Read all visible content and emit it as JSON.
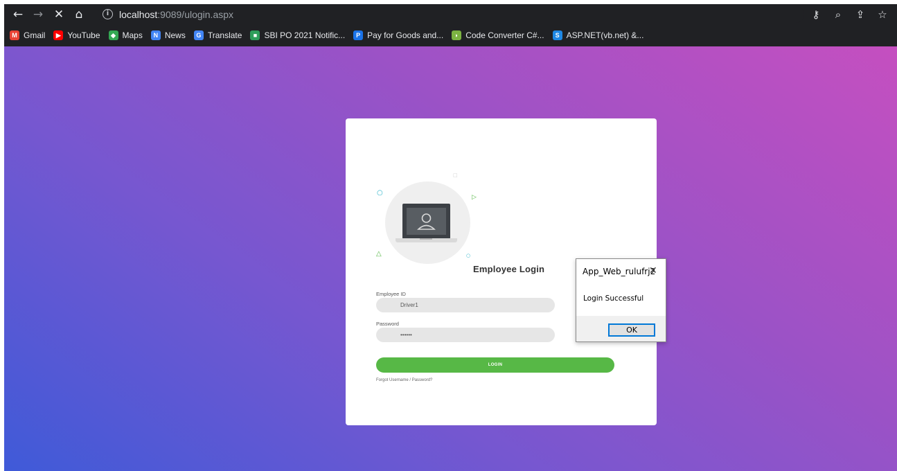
{
  "browser": {
    "url_host": "localhost",
    "url_rest": ":9089/ulogin.aspx",
    "bookmarks": [
      {
        "label": "Gmail",
        "icon": "gmail-icon",
        "color": "#ea4335",
        "glyph": "M"
      },
      {
        "label": "YouTube",
        "icon": "youtube-icon",
        "color": "#ff0000",
        "glyph": "▶"
      },
      {
        "label": "Maps",
        "icon": "maps-icon",
        "color": "#34a853",
        "glyph": "◆"
      },
      {
        "label": "News",
        "icon": "news-icon",
        "color": "#4285f4",
        "glyph": "N"
      },
      {
        "label": "Translate",
        "icon": "translate-icon",
        "color": "#4285f4",
        "glyph": "G"
      },
      {
        "label": "SBI PO 2021 Notific...",
        "icon": "bookmark-green-icon",
        "color": "#2e9e5b",
        "glyph": "■"
      },
      {
        "label": "Pay for Goods and...",
        "icon": "paypal-icon",
        "color": "#1a73e8",
        "glyph": "P"
      },
      {
        "label": "Code Converter C#...",
        "icon": "code-converter-icon",
        "color": "#7cb342",
        "glyph": "◗"
      },
      {
        "label": "ASP.NET(vb.net) &...",
        "icon": "asp-net-icon",
        "color": "#1e88e5",
        "glyph": "S"
      }
    ]
  },
  "login": {
    "title": "Employee Login",
    "employee_id_label": "Employee ID",
    "employee_id_value": "Driver1",
    "password_label": "Password",
    "password_value": "••••••",
    "button_label": "LOGIN",
    "forgot_prefix": "Forgot ",
    "forgot_link": "Username / Password?"
  },
  "dialog": {
    "title": "App_Web_rulufrj2",
    "message": "Login Successful",
    "ok_label": "OK"
  },
  "colors": {
    "accent_green": "#57b846",
    "gradient_start": "#3f5ad8",
    "gradient_end": "#c54fc0"
  }
}
